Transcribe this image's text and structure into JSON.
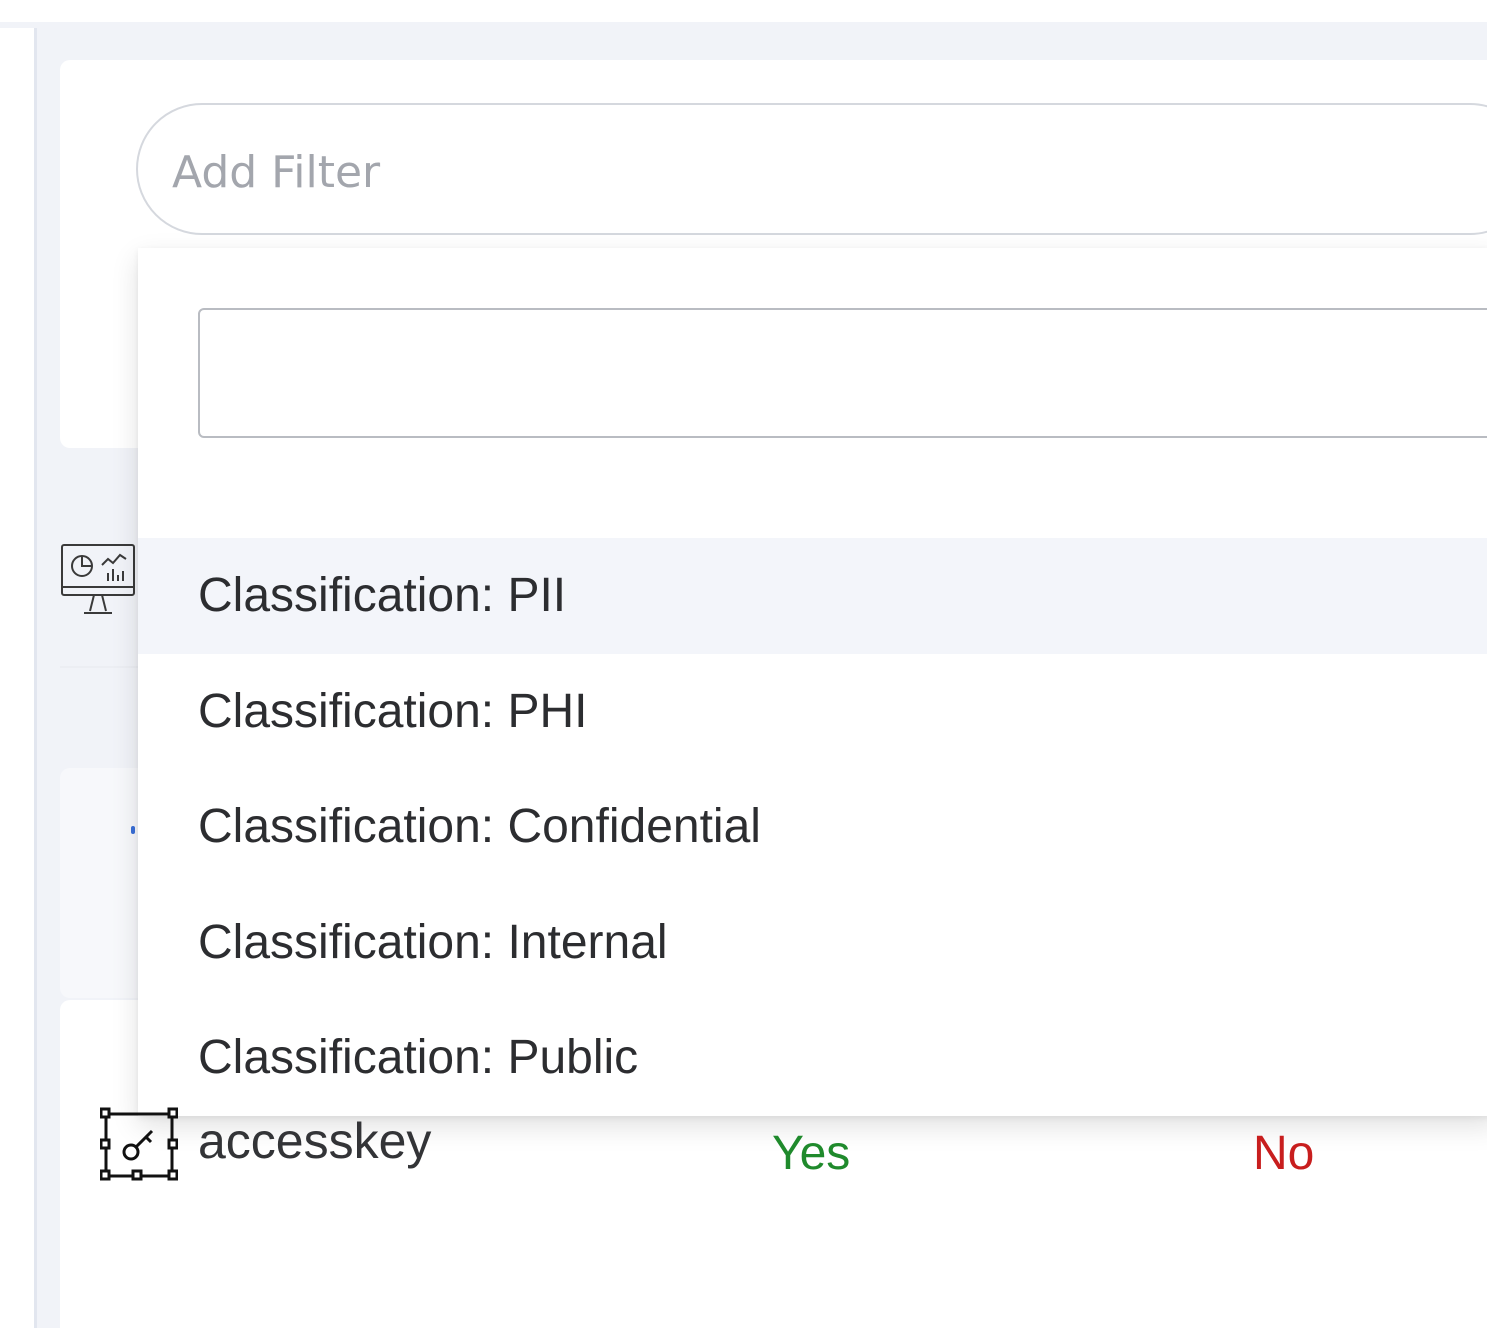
{
  "filter": {
    "placeholder": "Add Filter"
  },
  "dropdown": {
    "search_value": "",
    "options": [
      {
        "label": "Classification: PII",
        "highlighted": true
      },
      {
        "label": "Classification: PHI",
        "highlighted": false
      },
      {
        "label": "Classification: Confidential",
        "highlighted": false
      },
      {
        "label": "Classification: Internal",
        "highlighted": false
      },
      {
        "label": "Classification: Public",
        "highlighted": false
      }
    ]
  },
  "icons": {
    "dashboard": "dashboard-monitor-icon",
    "row": "access-key-icon"
  },
  "table": {
    "rows": [
      {
        "name": "accesskey",
        "col1": "Yes",
        "col2": "No"
      }
    ]
  },
  "colors": {
    "yes": "#1f8a2c",
    "no": "#c81e1e",
    "highlight": "#f3f5fa"
  }
}
